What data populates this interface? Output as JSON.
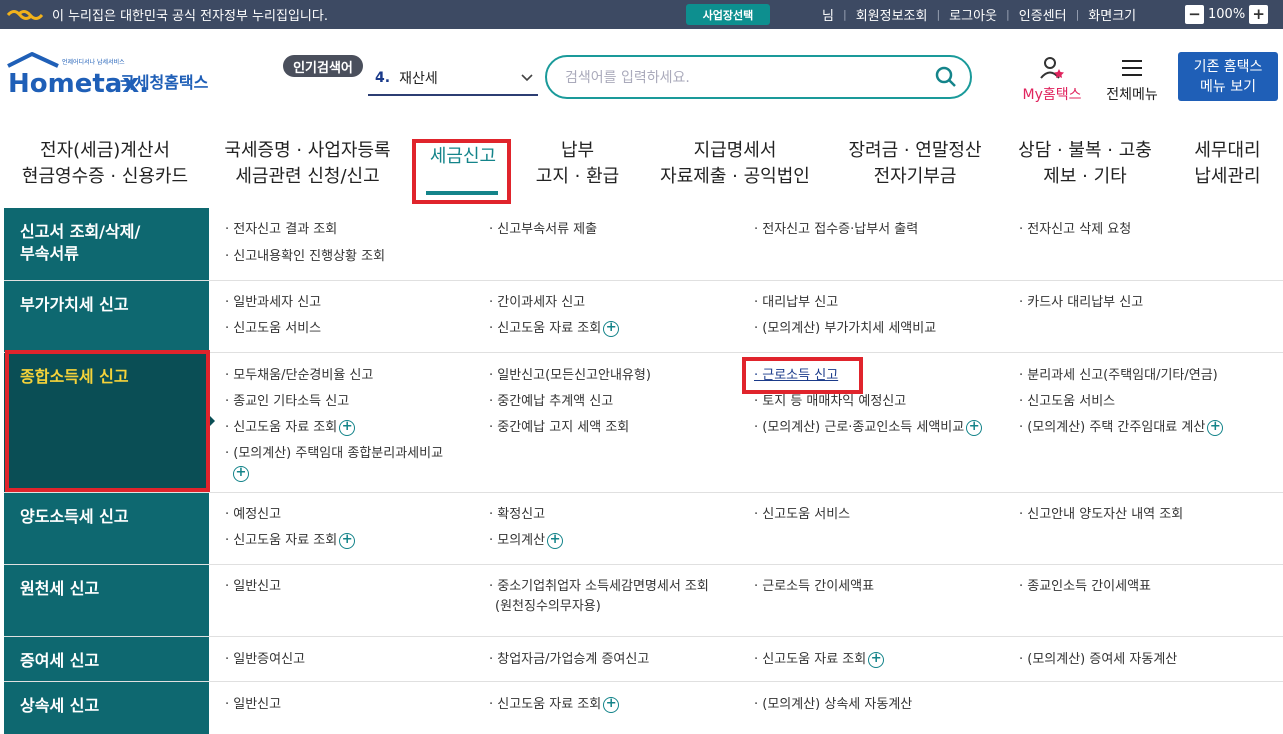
{
  "topbar": {
    "gov_text": "이 누리집은 대한민국 공식 전자정부 누리집입니다.",
    "biz_select": "사업장선택",
    "links": [
      "님",
      "회원정보조회",
      "로그아웃",
      "인증센터",
      "화면크기"
    ],
    "zoom_minus": "−",
    "zoom_value": "100%",
    "zoom_plus": "+"
  },
  "header": {
    "logo_small": "언제어디서나 납세서비스",
    "logo_brand": "Hometax.",
    "logo_kor": "국세청홈택스",
    "popular_label": "인기검색어",
    "popular_num": "4.",
    "popular_value": "재산세",
    "search_placeholder": "검색어를 입력하세요.",
    "my_hometax": "My홈택스",
    "all_menu": "전체메뉴",
    "old_home_line1": "기존 홈택스",
    "old_home_line2": "메뉴 보기"
  },
  "gnb": [
    {
      "l1": "전자(세금)계산서",
      "l2": "현금영수증 · 신용카드"
    },
    {
      "l1": "국세증명 · 사업자등록",
      "l2": "세금관련 신청/신고"
    },
    {
      "l1": "세금신고",
      "l2": ""
    },
    {
      "l1": "납부",
      "l2": "고지 · 환급"
    },
    {
      "l1": "지급명세서",
      "l2": "자료제출 · 공익법인"
    },
    {
      "l1": "장려금 · 연말정산",
      "l2": "전자기부금"
    },
    {
      "l1": "상담 · 불복 · 고충",
      "l2": "제보 · 기타"
    },
    {
      "l1": "세무대리",
      "l2": "납세관리"
    }
  ],
  "menu": [
    {
      "head": "신고서 조회/삭제/\n부속서류",
      "links": [
        "· 전자신고 결과 조회",
        "· 신고부속서류 제출",
        "· 전자신고 접수증·납부서 출력",
        "· 전자신고 삭제 요청",
        "· 신고내용확인 진행상황 조회"
      ]
    },
    {
      "head": "부가가치세 신고",
      "links": [
        "· 일반과세자 신고",
        "· 간이과세자 신고",
        "· 대리납부 신고",
        "· 카드사 대리납부 신고",
        "· 신고도움 서비스",
        "· 신고도움 자료 조회",
        "· (모의계산) 부가가치세 세액비교"
      ]
    },
    {
      "head": "종합소득세 신고",
      "links": [
        "· 모두채움/단순경비율 신고",
        "· 일반신고(모든신고안내유형)",
        "· 근로소득 신고",
        "· 분리과세 신고(주택임대/기타/연금)",
        "· 종교인 기타소득 신고",
        "· 중간예납 추계액 신고",
        "· 토지 등 매매차익 예정신고",
        "· 신고도움 서비스",
        "· 신고도움 자료 조회",
        "· 중간예납 고지 세액 조회",
        "· (모의계산) 근로·종교인소득 세액비교",
        "· (모의계산) 주택 간주임대료 계산",
        "· (모의계산) 주택임대 종합분리과세비교"
      ]
    },
    {
      "head": "양도소득세 신고",
      "links": [
        "· 예정신고",
        "· 확정신고",
        "· 신고도움 서비스",
        "· 신고안내 양도자산 내역 조회",
        "· 신고도움 자료 조회",
        "· 모의계산"
      ]
    },
    {
      "head": "원천세 신고",
      "links": [
        "· 일반신고",
        "· 중소기업취업자 소득세감면명세서 조회",
        "(원천징수의무자용)",
        "· 근로소득 간이세액표",
        "· 종교인소득 간이세액표"
      ]
    },
    {
      "head": "증여세 신고",
      "links": [
        "· 일반증여신고",
        "· 창업자금/가업승계 증여신고",
        "· 신고도움 자료 조회",
        "· (모의계산) 증여세 자동계산"
      ]
    },
    {
      "head": "상속세 신고",
      "links": [
        "· 일반신고",
        "· 신고도움 자료 조회",
        "· (모의계산) 상속세 자동계산"
      ]
    }
  ],
  "colors": {
    "topbar": "#3d4a63",
    "accent": "#14848a",
    "sidebar": "#0e6870",
    "highlight": "#e0242c"
  }
}
